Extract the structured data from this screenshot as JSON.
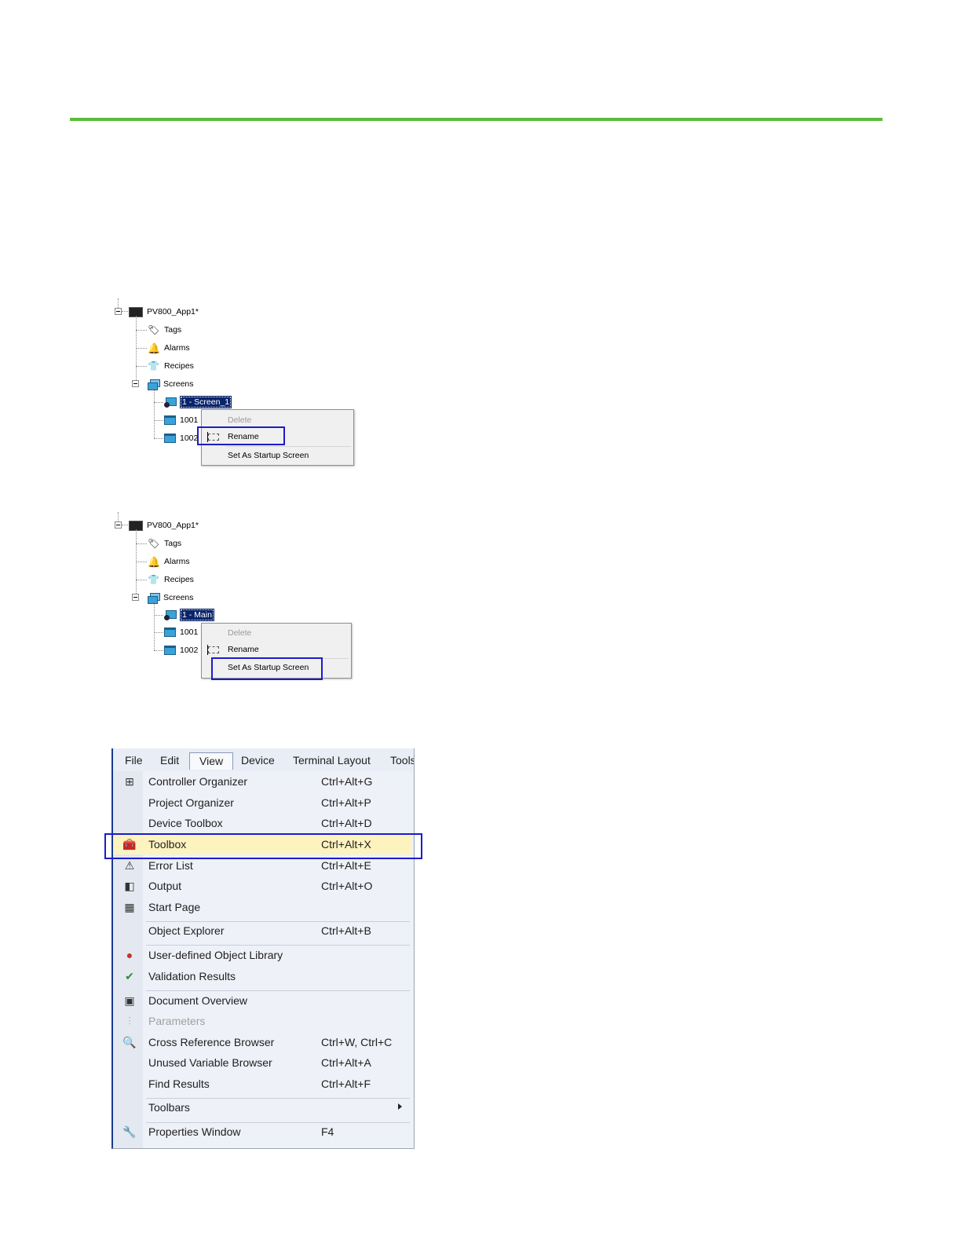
{
  "colors": {
    "rule": "#5bbc3a",
    "highlight_box": "#1c1cc9",
    "selection": "#0a246a",
    "menu_highlight": "#fdf3bf"
  },
  "tree1": {
    "root": "PV800_App1*",
    "tags": "Tags",
    "alarms": "Alarms",
    "recipes": "Recipes",
    "screens": "Screens",
    "screen1": "1 - Screen_1",
    "screen1001": "1001",
    "screen1002": "1002",
    "context": {
      "delete": "Delete",
      "rename": "Rename",
      "startup": "Set As Startup Screen"
    }
  },
  "tree2": {
    "root": "PV800_App1*",
    "tags": "Tags",
    "alarms": "Alarms",
    "recipes": "Recipes",
    "screens": "Screens",
    "screen1": "1 - Main",
    "screen1001": "1001",
    "screen1002": "1002",
    "context": {
      "delete": "Delete",
      "rename": "Rename",
      "startup": "Set As Startup Screen"
    }
  },
  "menubar": [
    "File",
    "Edit",
    "View",
    "Device",
    "Terminal Layout",
    "Tools"
  ],
  "view_menu": [
    {
      "label": "Controller Organizer",
      "shortcut": "Ctrl+Alt+G",
      "icon": "controller-organizer-icon"
    },
    {
      "label": "Project Organizer",
      "shortcut": "Ctrl+Alt+P",
      "icon": ""
    },
    {
      "label": "Device Toolbox",
      "shortcut": "Ctrl+Alt+D",
      "icon": ""
    },
    {
      "label": "Toolbox",
      "shortcut": "Ctrl+Alt+X",
      "icon": "toolbox-icon",
      "highlighted": true
    },
    {
      "label": "Error List",
      "shortcut": "Ctrl+Alt+E",
      "icon": "error-list-icon"
    },
    {
      "label": "Output",
      "shortcut": "Ctrl+Alt+O",
      "icon": "output-icon"
    },
    {
      "label": "Start Page",
      "shortcut": "",
      "icon": "start-page-icon"
    },
    {
      "label": "Object Explorer",
      "shortcut": "Ctrl+Alt+B",
      "icon": ""
    },
    {
      "label": "User-defined Object Library",
      "shortcut": "",
      "icon": "object-library-icon"
    },
    {
      "label": "Validation Results",
      "shortcut": "",
      "icon": "validation-icon"
    },
    {
      "label": "Document Overview",
      "shortcut": "",
      "icon": "document-overview-icon"
    },
    {
      "label": "Parameters",
      "shortcut": "",
      "icon": "parameters-icon",
      "disabled": true
    },
    {
      "label": "Cross Reference Browser",
      "shortcut": "Ctrl+W, Ctrl+C",
      "icon": "search-icon"
    },
    {
      "label": "Unused Variable Browser",
      "shortcut": "Ctrl+Alt+A",
      "icon": ""
    },
    {
      "label": "Find Results",
      "shortcut": "Ctrl+Alt+F",
      "icon": ""
    },
    {
      "label": "Toolbars",
      "shortcut": "",
      "icon": "",
      "submenu": true
    },
    {
      "label": "Properties Window",
      "shortcut": "F4",
      "icon": "wrench-icon"
    }
  ]
}
